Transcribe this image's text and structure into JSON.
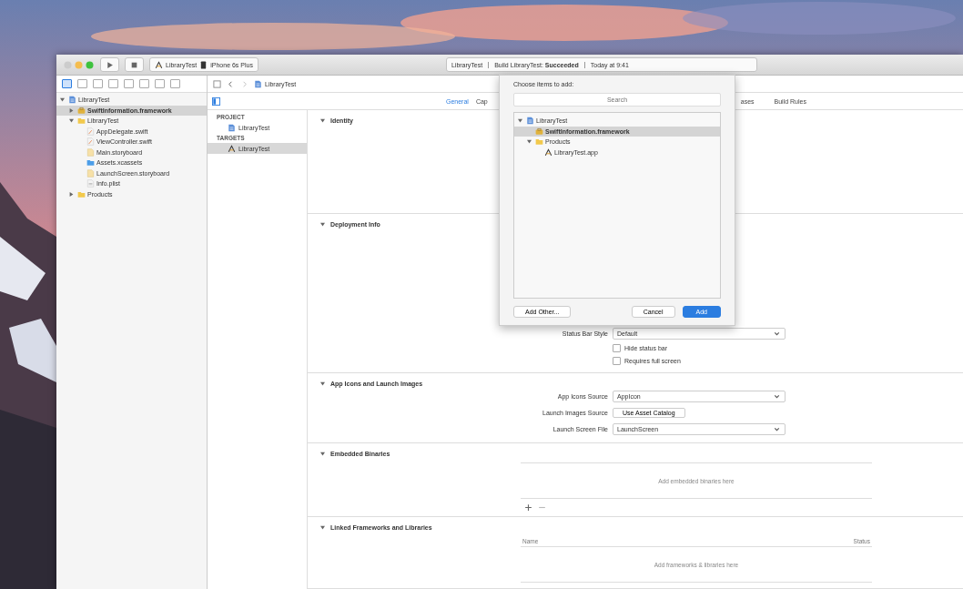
{
  "window": {
    "scheme": "LibraryTest",
    "device": "iPhone 6s Plus",
    "status": {
      "project": "LibraryTest",
      "message": "Build LibraryTest: **Succeeded**",
      "time": "Today at 9:41"
    }
  },
  "navigator_tabs": [
    {
      "selected": true
    },
    {
      "selected": false
    },
    {
      "selected": false
    },
    {
      "selected": false
    },
    {
      "selected": false
    },
    {
      "selected": false
    },
    {
      "selected": false
    },
    {
      "selected": false
    }
  ],
  "sidebar": {
    "items": [
      {
        "label": "LibraryTest",
        "kind": "project",
        "selected": false,
        "expanded": true,
        "children": [
          {
            "label": "SwiftInformation.framework",
            "kind": "framework",
            "selected": true,
            "expanded": false
          },
          {
            "label": "LibraryTest",
            "kind": "folder",
            "selected": false,
            "expanded": true,
            "children": [
              {
                "label": "AppDelegate.swift",
                "kind": "swift",
                "selected": false
              },
              {
                "label": "ViewController.swift",
                "kind": "swift",
                "selected": false
              },
              {
                "label": "Main.storyboard",
                "kind": "storyboard",
                "selected": false
              },
              {
                "label": "Assets.xcassets",
                "kind": "assets",
                "selected": false
              },
              {
                "label": "LaunchScreen.storyboard",
                "kind": "storyboard",
                "selected": false
              },
              {
                "label": "Info.plist",
                "kind": "plist",
                "selected": false
              }
            ]
          },
          {
            "label": "Products",
            "kind": "folder",
            "selected": false,
            "expanded": false
          }
        ]
      }
    ]
  },
  "jump_bar": {
    "path": "LibraryTest"
  },
  "project_list": {
    "groups": [
      {
        "header": "PROJECT",
        "items": [
          {
            "label": "LibraryTest",
            "kind": "project",
            "selected": false
          }
        ]
      },
      {
        "header": "TARGETS",
        "items": [
          {
            "label": "LibraryTest",
            "kind": "app",
            "selected": true
          }
        ]
      }
    ]
  },
  "tabs": [
    {
      "label": "General",
      "selected": true
    },
    {
      "label": "Cap",
      "selected": false
    },
    {
      "label": "ases",
      "selected": false
    },
    {
      "label": "Build Rules",
      "selected": false
    }
  ],
  "sections": [
    {
      "title": "Identity"
    },
    {
      "title": "Deployment Info",
      "rows": [
        {
          "kind": "popup",
          "label": "Status Bar Style",
          "value": "Default"
        },
        {
          "kind": "checkbox",
          "label": "Hide status bar",
          "checked": false
        },
        {
          "kind": "checkbox",
          "label": "Requires full screen",
          "checked": false
        }
      ]
    },
    {
      "title": "App Icons and Launch Images",
      "rows": [
        {
          "kind": "popup",
          "label": "App Icons Source",
          "value": "AppIcon"
        },
        {
          "kind": "button",
          "label": "Launch Images Source",
          "value": "Use Asset Catalog"
        },
        {
          "kind": "popup",
          "label": "Launch Screen File",
          "value": "LaunchScreen"
        }
      ]
    },
    {
      "title": "Embedded Binaries",
      "table": {
        "empty": "Add embedded binaries here",
        "controls": true
      }
    },
    {
      "title": "Linked Frameworks and Libraries",
      "table": {
        "columns": [
          "Name",
          "Status"
        ],
        "empty": "Add frameworks & libraries here"
      }
    }
  ],
  "dialog": {
    "title": "Choose items to add:",
    "search_placeholder": "Search",
    "tree": [
      {
        "label": "LibraryTest",
        "kind": "project",
        "selected": false,
        "expanded": true,
        "children": [
          {
            "label": "SwiftInformation.framework",
            "kind": "framework",
            "selected": true
          },
          {
            "label": "Products",
            "kind": "folder",
            "selected": false,
            "expanded": true,
            "children": [
              {
                "label": "LibraryTest.app",
                "kind": "app",
                "selected": false
              }
            ]
          }
        ]
      }
    ],
    "buttons": [
      {
        "label": "Add Other...",
        "kind": "secondary"
      },
      {
        "label": "Cancel",
        "kind": "secondary"
      },
      {
        "label": "Add",
        "kind": "primary"
      }
    ]
  }
}
